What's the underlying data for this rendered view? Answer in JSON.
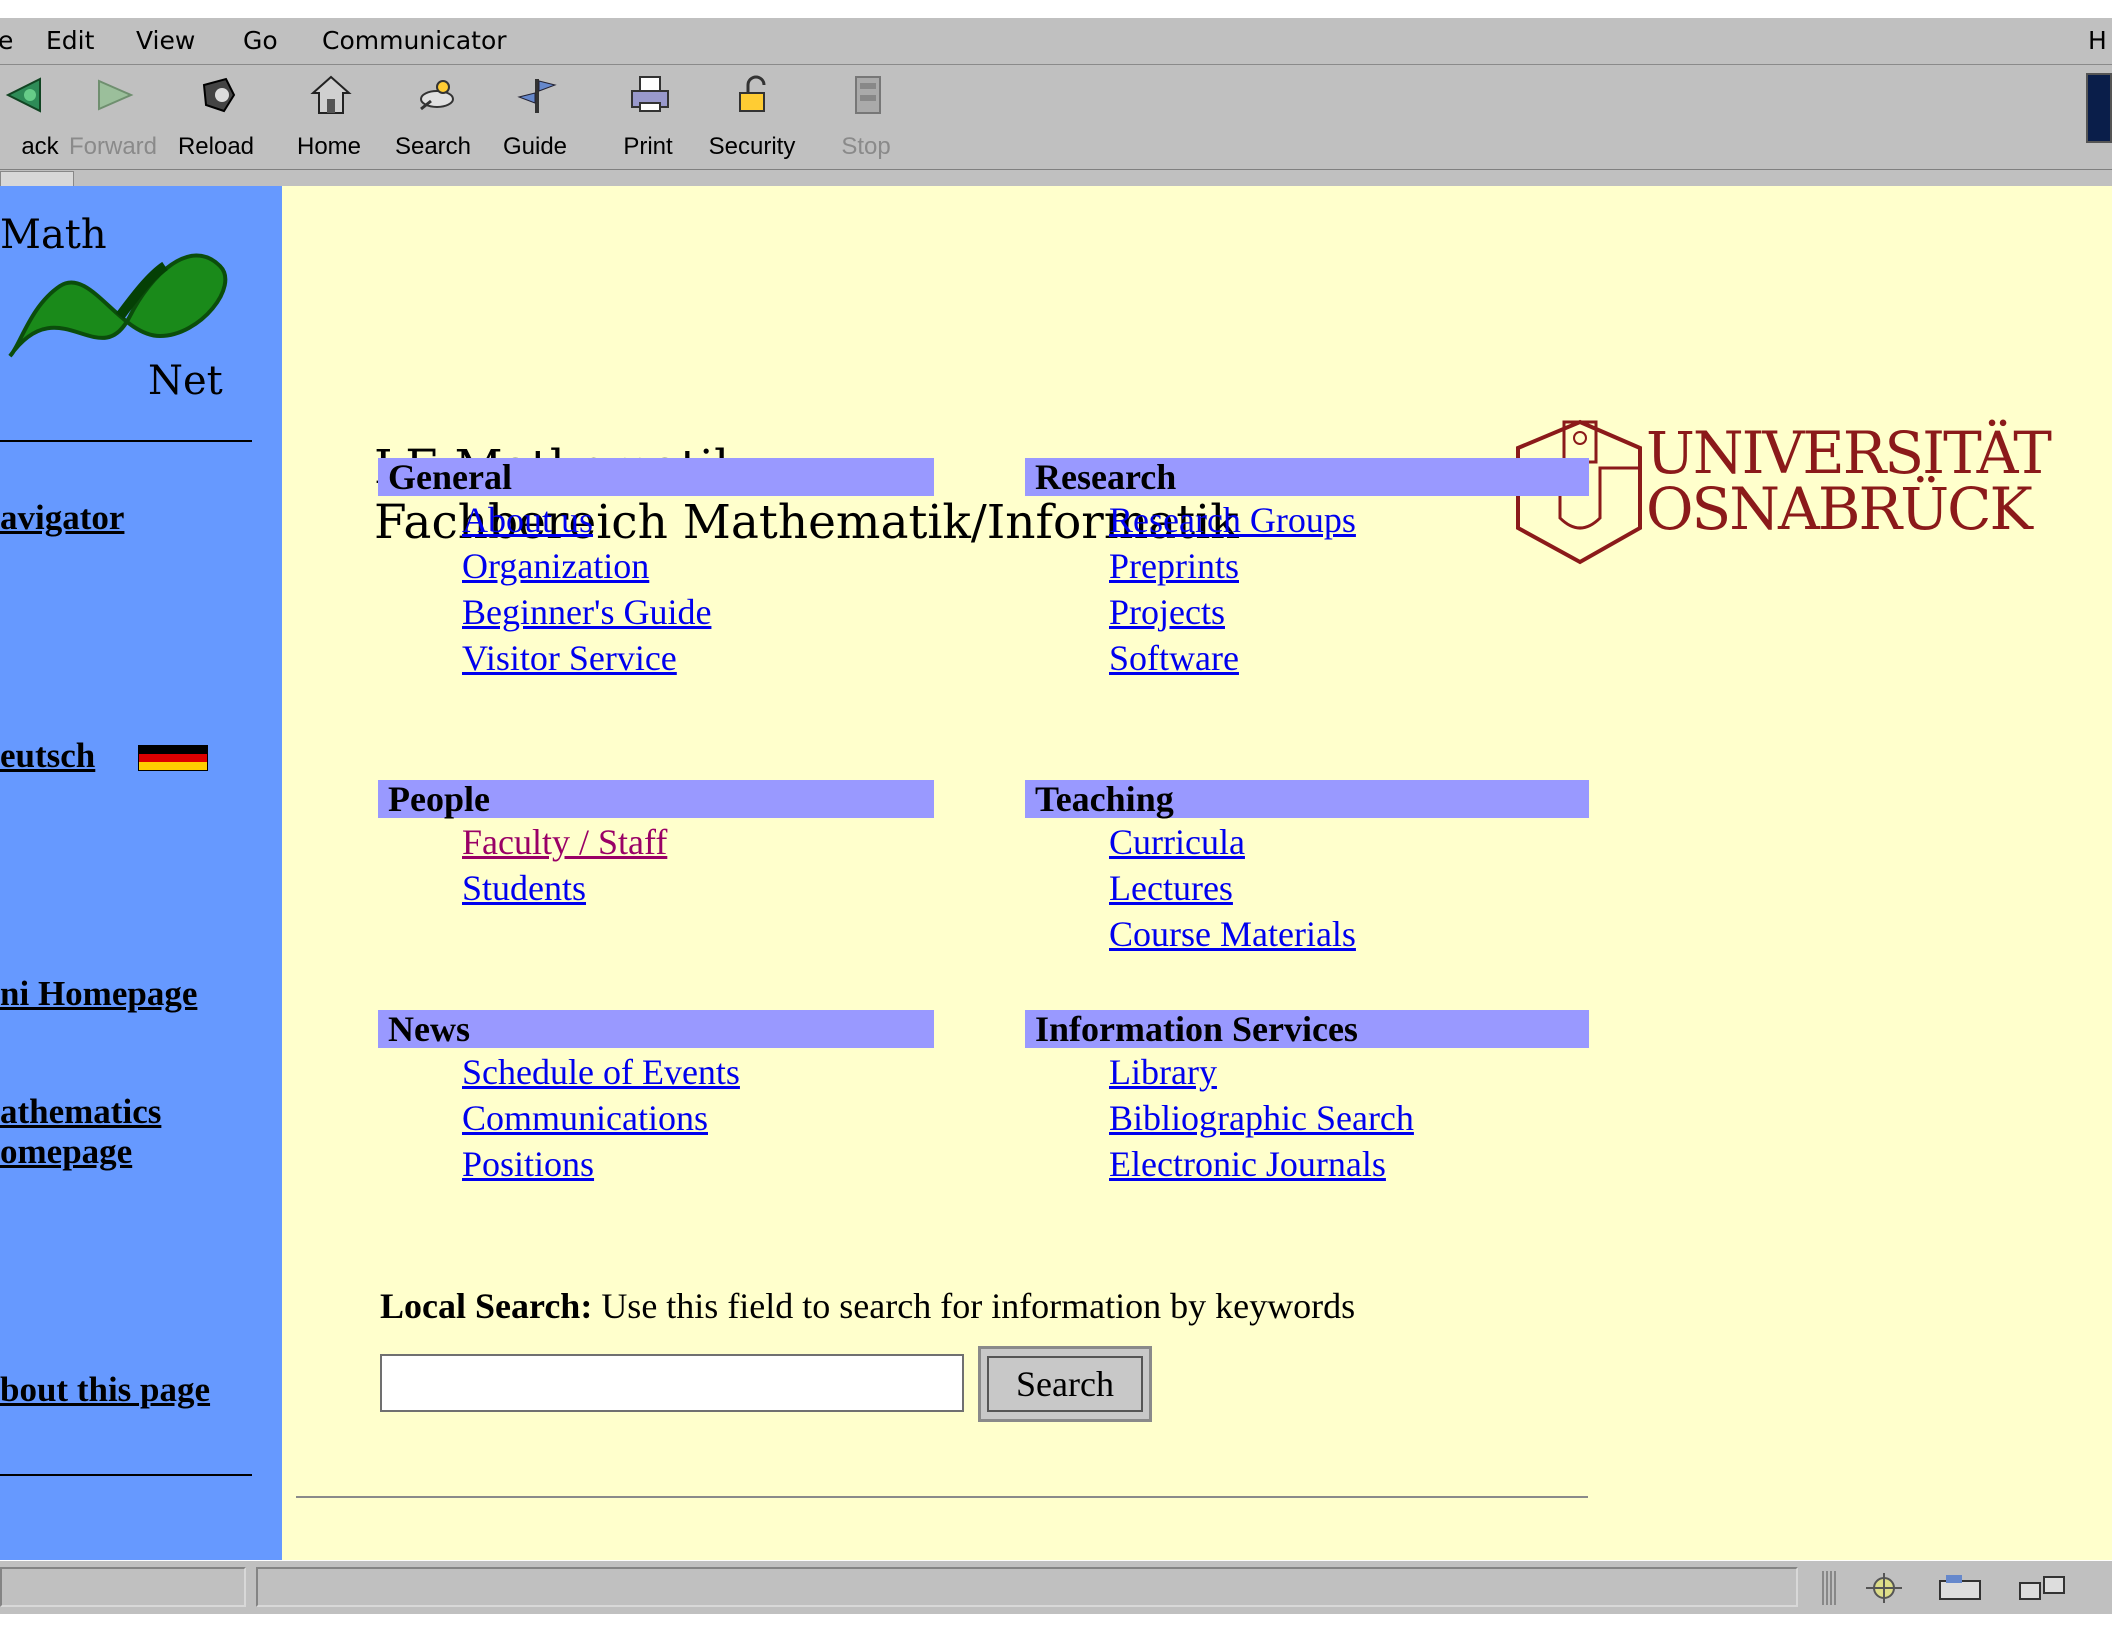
{
  "menubar": {
    "items": [
      "e",
      "Edit",
      "View",
      "Go",
      "Communicator"
    ],
    "right_label": "H"
  },
  "toolbar": {
    "buttons": [
      {
        "label": "ack",
        "icon": "back-arrow-icon",
        "enabled": true
      },
      {
        "label": "Forward",
        "icon": "forward-arrow-icon",
        "enabled": false
      },
      {
        "label": "Reload",
        "icon": "reload-icon",
        "enabled": true
      },
      {
        "label": "Home",
        "icon": "home-icon",
        "enabled": true
      },
      {
        "label": "Search",
        "icon": "search-icon",
        "enabled": true
      },
      {
        "label": "Guide",
        "icon": "guide-icon",
        "enabled": true
      },
      {
        "label": "Print",
        "icon": "printer-icon",
        "enabled": true
      },
      {
        "label": "Security",
        "icon": "padlock-icon",
        "enabled": true
      },
      {
        "label": "Stop",
        "icon": "stop-icon",
        "enabled": false
      }
    ]
  },
  "sidebar": {
    "logo": {
      "top_text": "Math",
      "bottom_text": "Net",
      "icon": "math-net-ribbon-logo"
    },
    "links": [
      "avigator",
      "eutsch",
      "ni Homepage",
      "athematics",
      "omepage",
      "bout this page"
    ],
    "flag_icon": "german-flag-icon"
  },
  "page": {
    "title_line1": "LE Mathematik",
    "title_line2": "Fachbereich Mathematik/Informatik",
    "university_logo": {
      "line1": "UNIVERSITÄT",
      "line2": "OSNABRÜCK",
      "icon": "university-seal-icon",
      "color": "#8b1a1a"
    }
  },
  "sections": {
    "general": {
      "title": "General",
      "links": [
        "About us",
        "Organization",
        "Beginner's Guide",
        "Visitor Service"
      ]
    },
    "research": {
      "title": "Research",
      "links": [
        "Research Groups",
        "Preprints",
        "Projects",
        "Software"
      ]
    },
    "people": {
      "title": "People",
      "links": [
        "Faculty / Staff",
        "Students"
      ]
    },
    "teaching": {
      "title": "Teaching",
      "links": [
        "Curricula",
        "Lectures",
        "Course Materials"
      ]
    },
    "news": {
      "title": "News",
      "links": [
        "Schedule of Events",
        "Communications",
        "Positions"
      ]
    },
    "info": {
      "title": "Information Services",
      "links": [
        "Library",
        "Bibliographic Search",
        "Electronic Journals"
      ]
    }
  },
  "search": {
    "label": "Local Search:",
    "description": " Use this field to search for information by keywords",
    "input_value": "",
    "button_label": "Search"
  },
  "colors": {
    "sidebar_bg": "#6699ff",
    "content_bg": "#ffffcc",
    "section_header_bg": "#9999ff",
    "link": "#0000ee",
    "visited_link": "#990066"
  },
  "statusbar": {
    "icons": [
      "network-icon",
      "mail-icon",
      "composer-icon"
    ]
  }
}
